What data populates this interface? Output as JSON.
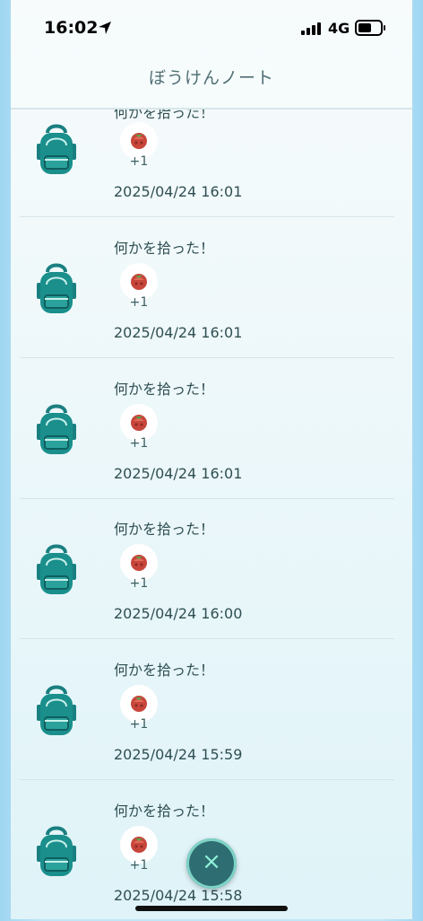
{
  "status_bar": {
    "time": "16:02",
    "network": "4G"
  },
  "header": {
    "title": "ぼうけんノート"
  },
  "entries": [
    {
      "message": "何かを拾った！",
      "count": "+1",
      "date": "2025/04/24 16:01"
    },
    {
      "message": "何かを拾った！",
      "count": "+1",
      "date": "2025/04/24 16:01"
    },
    {
      "message": "何かを拾った！",
      "count": "+1",
      "date": "2025/04/24 16:01"
    },
    {
      "message": "何かを拾った！",
      "count": "+1",
      "date": "2025/04/24 16:00"
    },
    {
      "message": "何かを拾った！",
      "count": "+1",
      "date": "2025/04/24 15:59"
    },
    {
      "message": "何かを拾った！",
      "count": "+1",
      "date": "2025/04/24 15:58"
    }
  ],
  "close_button": {
    "label": "×"
  },
  "colors": {
    "accent": "#1f8a8a",
    "text": "#2f4f53"
  }
}
